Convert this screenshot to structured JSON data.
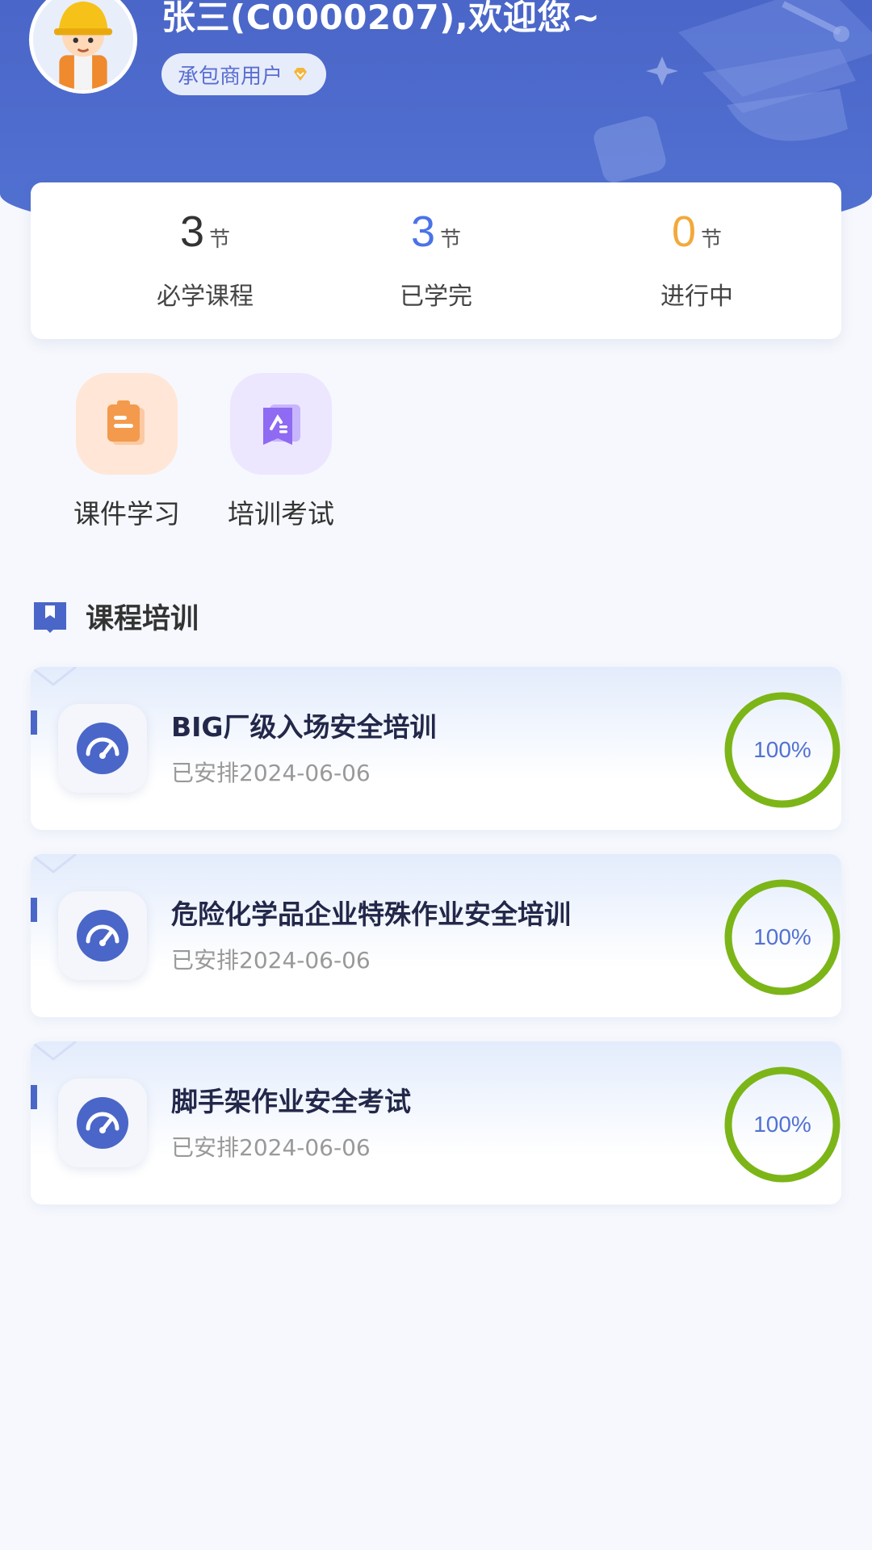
{
  "header": {
    "greeting": "张三(C0000207),欢迎您~",
    "role_badge": "承包商用户",
    "avatar_icon": "worker-avatar-icon",
    "badge_icon": "diamond-icon"
  },
  "stats": [
    {
      "value": "3",
      "unit": "节",
      "label": "必学课程",
      "color": "#333333"
    },
    {
      "value": "3",
      "unit": "节",
      "label": "已学完",
      "color": "#4a73e8"
    },
    {
      "value": "0",
      "unit": "节",
      "label": "进行中",
      "color": "#f2a93b"
    }
  ],
  "entries": [
    {
      "label": "课件学习",
      "icon": "clipboard-icon",
      "bg": "#ffe6d6"
    },
    {
      "label": "培训考试",
      "icon": "exam-icon",
      "bg": "#ece7ff"
    }
  ],
  "section": {
    "title": "课程培训",
    "icon": "book-icon"
  },
  "courses": [
    {
      "title": "BIG厂级入场安全培训",
      "date": "已安排2024-06-06",
      "progress": 1.0,
      "percent_label": "100%"
    },
    {
      "title": "危险化学品企业特殊作业安全培训",
      "date": "已安排2024-06-06",
      "progress": 1.0,
      "percent_label": "100%"
    },
    {
      "title": "脚手架作业安全考试",
      "date": "已安排2024-06-06",
      "progress": 1.0,
      "percent_label": "100%"
    }
  ],
  "colors": {
    "primary": "#4a66c8",
    "progress_ring": "#7cb518",
    "accent_orange": "#f2a93b"
  }
}
